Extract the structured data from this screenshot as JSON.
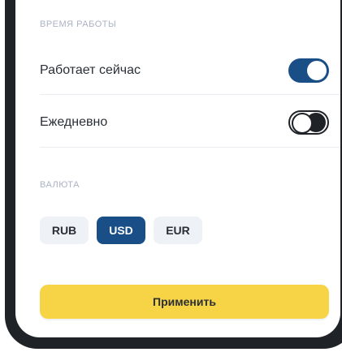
{
  "sections": {
    "hours_title": "ВРЕМЯ РАБОТЫ",
    "currency_title": "ВАЛЮТА"
  },
  "hours": [
    {
      "label": "Работает сейчас",
      "enabled": true
    },
    {
      "label": "Ежедневно",
      "enabled": false
    }
  ],
  "currency": {
    "options": [
      "RUB",
      "USD",
      "EUR"
    ],
    "selected": "USD"
  },
  "apply_button": "Применить",
  "colors": {
    "accent": "#1a4e86",
    "button": "#f6d446",
    "frame": "#1f2328"
  }
}
